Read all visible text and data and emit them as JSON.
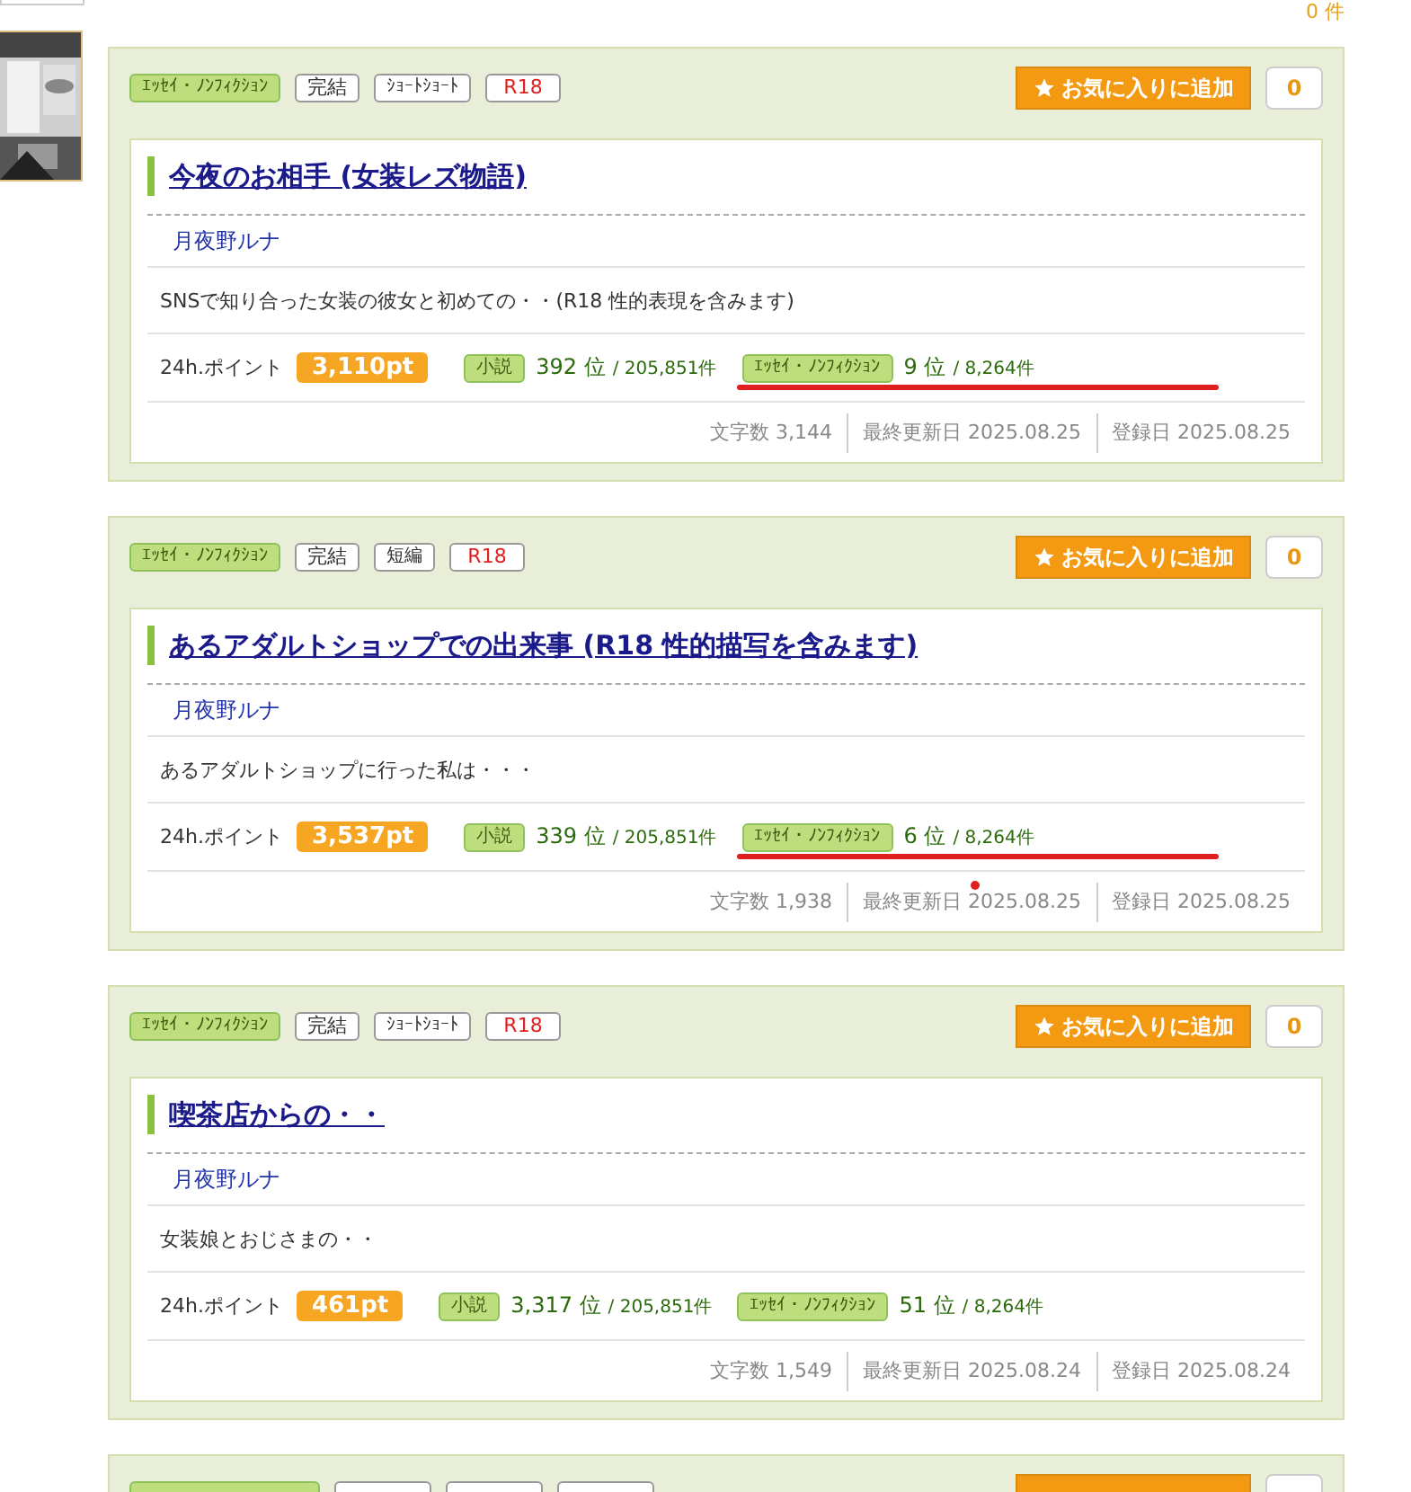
{
  "header": {
    "count": "0 件"
  },
  "works": [
    {
      "tags": [
        {
          "label": "ｴｯｾｲ・ﾉﾝﾌｨｸｼｮﾝ",
          "kind": "genre"
        },
        {
          "label": "完結",
          "kind": "status"
        },
        {
          "label": "ｼｮｰﾄｼｮｰﾄ",
          "kind": "length"
        },
        {
          "label": "R18",
          "kind": "rating"
        }
      ],
      "favorite_button": "お気に入りに追加",
      "favorite_count": "0",
      "title": "今夜のお相手 (女装レズ物語)",
      "author": "月夜野ルナ",
      "summary": "SNSで知り合った女装の彼女と初めての・・(R18 性的表現を含みます)",
      "points_label": "24h.ポイント",
      "points": "3,110pt",
      "rankings": [
        {
          "category": "小説",
          "rank": "392 位",
          "total": "/ 205,851件"
        },
        {
          "category": "ｴｯｾｲ・ﾉﾝﾌｨｸｼｮﾝ",
          "rank": "9 位",
          "total": "/ 8,264件"
        }
      ],
      "stats": [
        "文字数 3,144",
        "最終更新日 2025.08.25",
        "登録日 2025.08.25"
      ],
      "underlined": true
    },
    {
      "tags": [
        {
          "label": "ｴｯｾｲ・ﾉﾝﾌｨｸｼｮﾝ",
          "kind": "genre"
        },
        {
          "label": "完結",
          "kind": "status"
        },
        {
          "label": "短編",
          "kind": "length"
        },
        {
          "label": "R18",
          "kind": "rating"
        }
      ],
      "favorite_button": "お気に入りに追加",
      "favorite_count": "0",
      "title": "あるアダルトショップでの出来事 (R18 性的描写を含みます)",
      "author": "月夜野ルナ",
      "summary": "あるアダルトショップに行った私は・・・",
      "points_label": "24h.ポイント",
      "points": "3,537pt",
      "rankings": [
        {
          "category": "小説",
          "rank": "339 位",
          "total": "/ 205,851件"
        },
        {
          "category": "ｴｯｾｲ・ﾉﾝﾌｨｸｼｮﾝ",
          "rank": "6 位",
          "total": "/ 8,264件"
        }
      ],
      "stats": [
        "文字数 1,938",
        "最終更新日 2025.08.25",
        "登録日 2025.08.25"
      ],
      "underlined": true,
      "marker_dot": true
    },
    {
      "tags": [
        {
          "label": "ｴｯｾｲ・ﾉﾝﾌｨｸｼｮﾝ",
          "kind": "genre"
        },
        {
          "label": "完結",
          "kind": "status"
        },
        {
          "label": "ｼｮｰﾄｼｮｰﾄ",
          "kind": "length"
        },
        {
          "label": "R18",
          "kind": "rating"
        }
      ],
      "favorite_button": "お気に入りに追加",
      "favorite_count": "0",
      "title": "喫茶店からの・・",
      "author": "月夜野ルナ",
      "summary": "女装娘とおじさまの・・",
      "points_label": "24h.ポイント",
      "points": "461pt",
      "rankings": [
        {
          "category": "小説",
          "rank": "3,317 位",
          "total": "/ 205,851件"
        },
        {
          "category": "ｴｯｾｲ・ﾉﾝﾌｨｸｼｮﾝ",
          "rank": "51 位",
          "total": "/ 8,264件"
        }
      ],
      "stats": [
        "文字数 1,549",
        "最終更新日 2025.08.24",
        "登録日 2025.08.24"
      ]
    },
    {
      "tags": [
        {
          "kind": "genre"
        },
        {
          "kind": "status"
        },
        {
          "kind": "length"
        },
        {
          "kind": "rating"
        }
      ]
    }
  ]
}
